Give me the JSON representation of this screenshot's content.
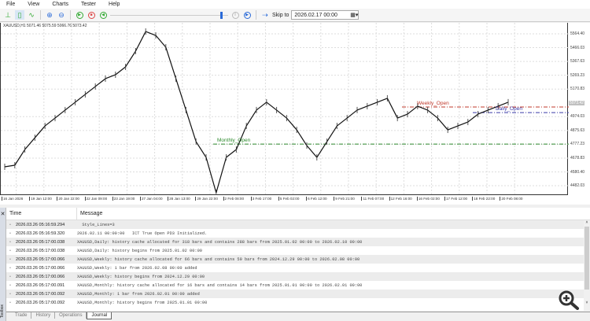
{
  "menu": [
    "File",
    "View",
    "Charts",
    "Tester",
    "Help"
  ],
  "toolbar": {
    "skip_label": "Skip to",
    "skip_date": "2026.02.17 00:00"
  },
  "chart": {
    "ohlc": "XAUUSD,H1  5071.46 5075.59 5066.76 5073.42",
    "current_price": "5073.42",
    "y_labels": [
      "5564.40",
      "5466.03",
      "5367.63",
      "5269.23",
      "5170.83",
      "4974.03",
      "4875.63",
      "4777.23",
      "4678.83",
      "4580.40",
      "4482.03"
    ],
    "y_values": [
      5564.4,
      5466.03,
      5367.63,
      5269.23,
      5170.83,
      4974.03,
      4875.63,
      4777.23,
      4678.83,
      4580.4,
      4482.03
    ],
    "x_labels": [
      "16 Jan 2026",
      "19 Jan 12:00",
      "20 Jan 22:00",
      "22 Jan 09:00",
      "23 Jan 19:00",
      "27 Jan 04:00",
      "28 Jan 13:00",
      "29 Jan 22:00",
      "2 Feb 08:00",
      "3 Feb 17:00",
      "5 Feb 02:00",
      "6 Feb 12:00",
      "9 Feb 21:00",
      "11 Feb 07:00",
      "12 Feb 16:00",
      "16 Feb 02:00",
      "17 Feb 12:00",
      "18 Feb 22:00",
      "20 Feb 08:00"
    ],
    "levels": [
      {
        "label": "Weekly_Open",
        "price": 5043,
        "color": "#c0392b"
      },
      {
        "label": "Daily_Open",
        "price": 5003,
        "color": "#3a3aa8"
      },
      {
        "label": "Monthly_Open",
        "price": 4779,
        "color": "#2e8b2e"
      }
    ],
    "prices": [
      4617,
      4628,
      4740,
      4824,
      4908,
      4964,
      5021,
      5077,
      5133,
      5189,
      5245,
      5273,
      5329,
      5441,
      5581,
      5553,
      5469,
      5245,
      5021,
      4796,
      4684,
      4432,
      4684,
      4740,
      4908,
      5021,
      5077,
      5021,
      4964,
      4880,
      4768,
      4684,
      4796,
      4908,
      4964,
      5021,
      5049,
      5077,
      5105,
      4964,
      4992,
      5049,
      5021,
      4964,
      4880,
      4908,
      4936,
      4992,
      5021,
      5049,
      5077
    ]
  },
  "journal": {
    "col_time": "Time",
    "col_message": "Message",
    "rows": [
      {
        "time": "2026.03.26 05:16:59.294",
        "msg": "  Style_Lines=3"
      },
      {
        "time": "2026.03.26 05:16:59.320",
        "msg": "2026.02.11 00:00:00   ICT True Open PD3 Initialized."
      },
      {
        "time": "2026.03.26 05:17:00.038",
        "msg": "XAUUSD,Daily: history cache allocated for 318 bars and contains 288 bars from 2025.01.02 00:00 to 2026.02.10 00:00"
      },
      {
        "time": "2026.03.26 05:17:00.038",
        "msg": "XAUUSD,Daily: history begins from 2025.01.02 00:00"
      },
      {
        "time": "2026.03.26 05:17:00.066",
        "msg": "XAUUSD,Weekly: history cache allocated for 66 bars and contains 59 bars from 2024.12.29 00:00 to 2026.02.08 00:00"
      },
      {
        "time": "2026.03.26 05:17:00.066",
        "msg": "XAUUSD,Weekly: 1 bar from 2026.02.08 00:00 added"
      },
      {
        "time": "2026.03.26 05:17:00.066",
        "msg": "XAUUSD,Weekly: history begins from 2024.12.29 00:00"
      },
      {
        "time": "2026.03.26 05:17:00.091",
        "msg": "XAUUSD,Monthly: history cache allocated for 16 bars and contains 14 bars from 2025.01.01 00:00 to 2026.02.01 00:00"
      },
      {
        "time": "2026.03.26 05:17:00.092",
        "msg": "XAUUSD,Monthly: 1 bar from 2026.02.01 00:00 added"
      },
      {
        "time": "2026.03.26 05:17:00.092",
        "msg": "XAUUSD,Monthly: history begins from 2025.01.01 00:00"
      }
    ]
  },
  "tabs": [
    "Trade",
    "History",
    "Operations",
    "Journal"
  ],
  "active_tab": "Journal",
  "toolbox_label": "Toolbox"
}
